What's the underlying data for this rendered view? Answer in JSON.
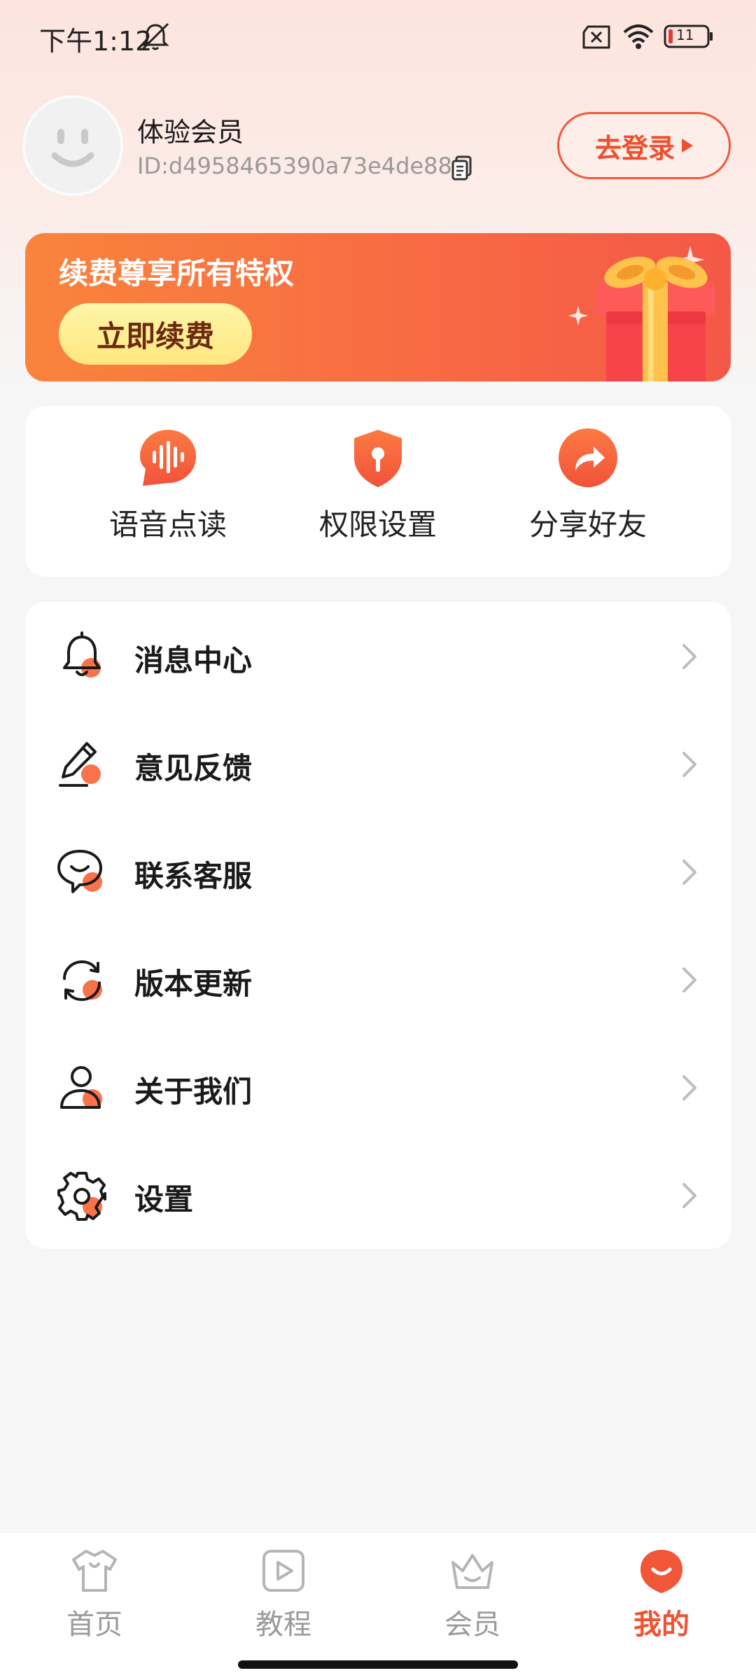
{
  "status_bar": {
    "time": "下午1:12",
    "battery": "11"
  },
  "profile": {
    "name": "体验会员",
    "id": "ID:d4958465390a73e4de88",
    "login_label": "去登录"
  },
  "banner": {
    "title": "续费尊享所有特权",
    "button": "立即续费"
  },
  "quick_actions": [
    {
      "label": "语音点读",
      "icon": "voice-wave-icon"
    },
    {
      "label": "权限设置",
      "icon": "shield-icon"
    },
    {
      "label": "分享好友",
      "icon": "share-arrow-icon"
    }
  ],
  "menu": [
    {
      "label": "消息中心",
      "icon": "bell-icon"
    },
    {
      "label": "意见反馈",
      "icon": "pen-icon"
    },
    {
      "label": "联系客服",
      "icon": "chat-bubble-icon"
    },
    {
      "label": "版本更新",
      "icon": "refresh-icon"
    },
    {
      "label": "关于我们",
      "icon": "person-icon"
    },
    {
      "label": "设置",
      "icon": "gear-icon"
    }
  ],
  "bottom_nav": [
    {
      "label": "首页",
      "icon": "shirt-icon"
    },
    {
      "label": "教程",
      "icon": "play-icon"
    },
    {
      "label": "会员",
      "icon": "crown-icon"
    },
    {
      "label": "我的",
      "icon": "smile-icon",
      "active": true
    }
  ],
  "colors": {
    "accent": "#f05233",
    "banner_start": "#f9843d",
    "banner_end": "#f45847",
    "button_yellow": "#fff0a0"
  }
}
